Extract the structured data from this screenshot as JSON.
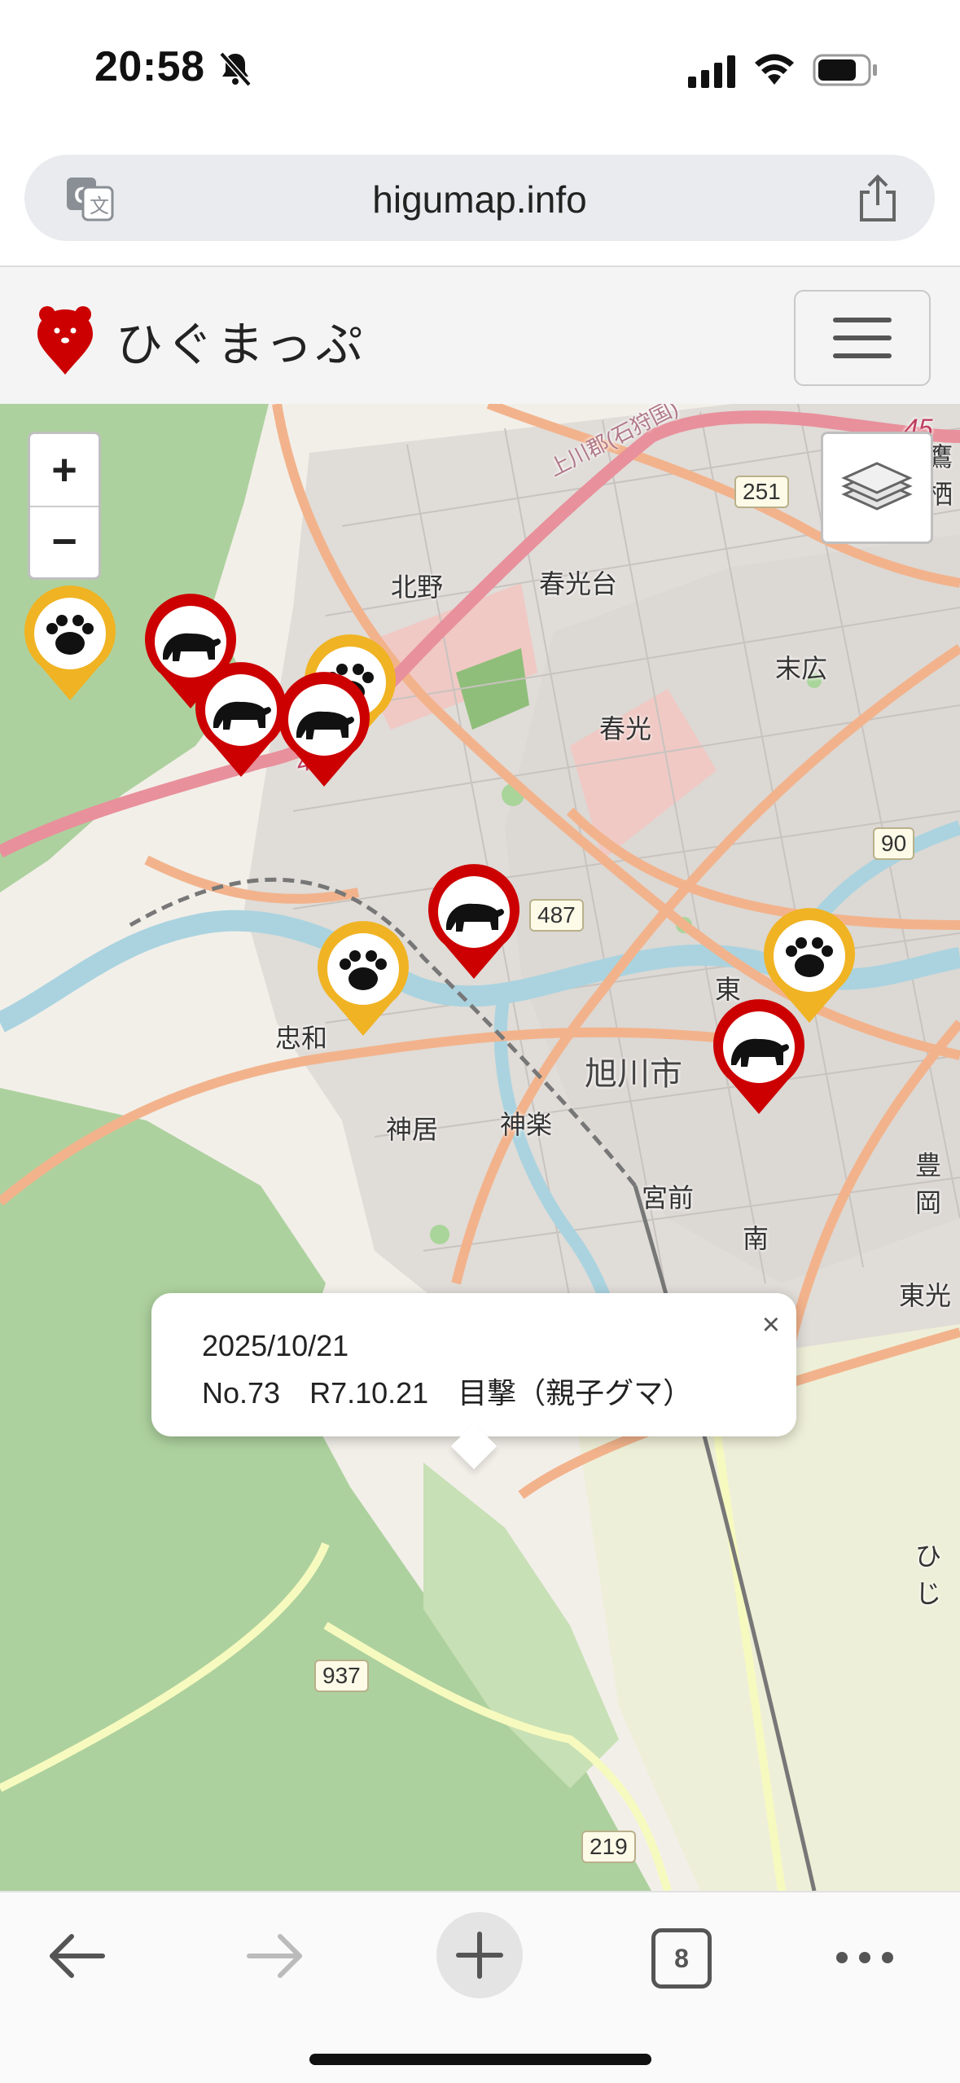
{
  "status_bar": {
    "time": "20:58"
  },
  "browser": {
    "url": "higumap.info",
    "tab_count": "8"
  },
  "site": {
    "title": "ひぐまっぷ"
  },
  "map": {
    "zoom_in": "+",
    "zoom_out": "−",
    "labels": {
      "kitano": "北野",
      "shunkodai": "春光台",
      "suehiro": "末広",
      "shunko": "春光",
      "higashi": "東",
      "asahikawa": "旭川市",
      "chuwa": "忠和",
      "kamui": "神居",
      "kagura": "神楽",
      "miyamae": "宮前",
      "minami": "南",
      "toyooka": "豊岡",
      "toko": "東光",
      "hiji": "ひじ",
      "kamikawa": "上川郡(石狩国)",
      "takasu": "鷹栖"
    },
    "routes": [
      "251",
      "44",
      "44",
      "90",
      "487",
      "937",
      "219",
      "45"
    ],
    "colors": {
      "sighting": "#cc0000",
      "footprint": "#f0b323"
    }
  },
  "popup": {
    "date": "2025/10/21",
    "description": "No.73　R7.10.21　目撃（親子グマ）",
    "close": "×"
  }
}
